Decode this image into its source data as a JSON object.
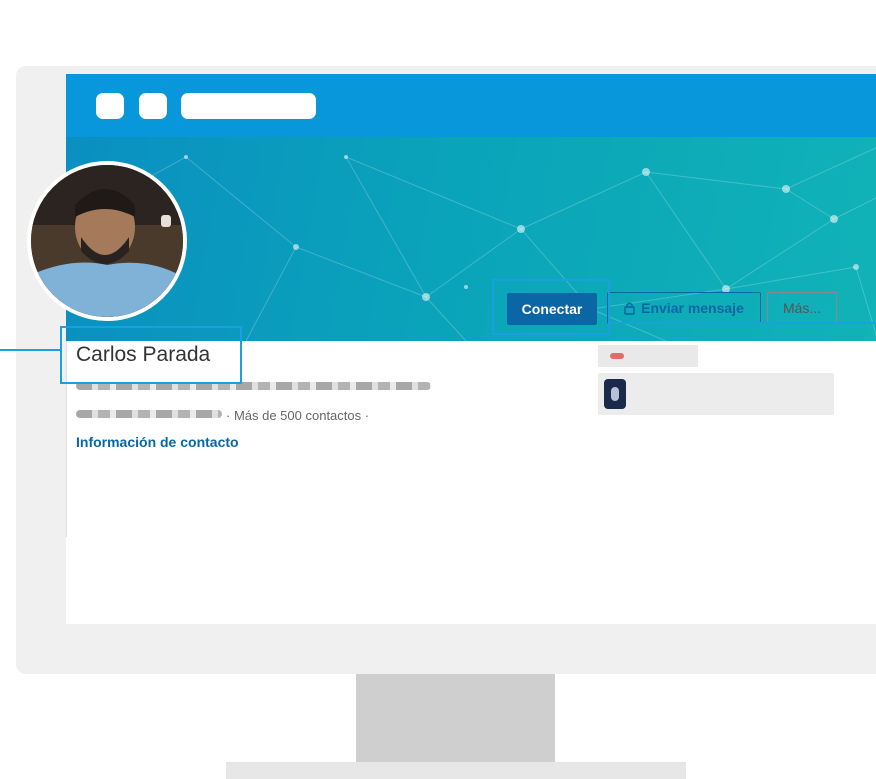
{
  "profile": {
    "name": "Carlos Parada",
    "connections_text": "· Más de 500 contactos ·",
    "contact_info_link": "Información de contacto"
  },
  "actions": {
    "connect_label": "Conectar",
    "message_label": "Enviar mensaje",
    "more_label": "Más..."
  },
  "icons": {
    "message_button_icon": "lock-icon"
  },
  "colors": {
    "browser_bar": "#0897da",
    "primary_button": "#0a66a5",
    "highlight": "#1aa0dc",
    "banner_start": "#0a8fc1",
    "banner_end": "#10b3b7"
  }
}
